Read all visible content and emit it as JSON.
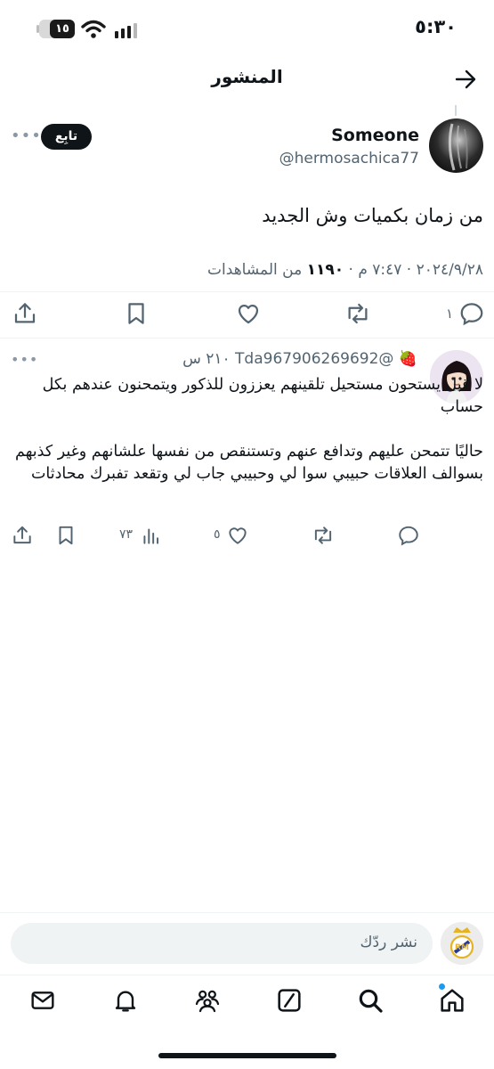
{
  "status_bar": {
    "time": "٥:٣٠",
    "battery": "١٥"
  },
  "header": {
    "title": "المنشور"
  },
  "post": {
    "author_name": "Someone",
    "author_handle": "@hermosachica77",
    "follow_label": "تابِع",
    "text": "من زمان بكميات وش الجديد",
    "meta_datetime": "٢٠٢٤/٩/٢٨ · ٧:٤٧ م ·",
    "meta_views": "١١٩٠",
    "meta_views_label": "من المشاهدات",
    "reply_count": "١"
  },
  "reply": {
    "emoji": "🍓",
    "handle": "@Tda967906269692",
    "time": "٢١٠ س",
    "paragraph1": "لا قبل يستحون مستحيل تلقينهم يعززون للذكور ويتمحنون عندهم بكل حساب",
    "paragraph2": "حاليًا تتمحن عليهم وتدافع عنهم وتستنقص من نفسها علشانهم وغير كذبهم بسوالف العلاقات حبيبي سوا لي وحبيبي جاب لي وتقعد تفبرك محادثات",
    "likes": "٥",
    "views": "٧٣"
  },
  "composer": {
    "placeholder": "نشر ردّك"
  },
  "icons": {
    "accent": "#1d9bf0",
    "nav": [
      "home-icon",
      "search-icon",
      "grok-icon",
      "communities-icon",
      "notifications-icon",
      "messages-icon"
    ]
  }
}
